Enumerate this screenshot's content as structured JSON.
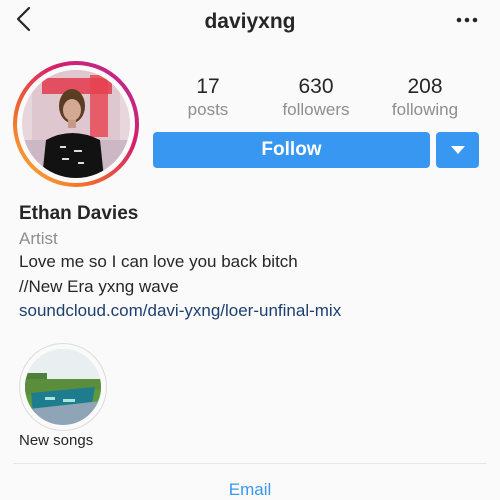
{
  "header": {
    "username": "daviyxng"
  },
  "stats": [
    {
      "value": "17",
      "label": "posts"
    },
    {
      "value": "630",
      "label": "followers"
    },
    {
      "value": "208",
      "label": "following"
    }
  ],
  "actions": {
    "follow_label": "Follow"
  },
  "profile": {
    "name": "Ethan Davies",
    "category": "Artist",
    "bio_line_1": "Love me so I can love you back bitch",
    "bio_line_2": "//New Era yxng wave",
    "link": "soundcloud.com/davi-yxng/loer-unfinal-mix"
  },
  "highlights": [
    {
      "label": "New songs"
    }
  ],
  "contact": {
    "email_label": "Email"
  },
  "colors": {
    "accent": "#3897f0",
    "link": "#1c3f71",
    "muted": "#8e8e8e"
  },
  "icons": {
    "back": "chevron-left-icon",
    "more": "more-dots-icon",
    "dropdown": "caret-down-icon"
  }
}
